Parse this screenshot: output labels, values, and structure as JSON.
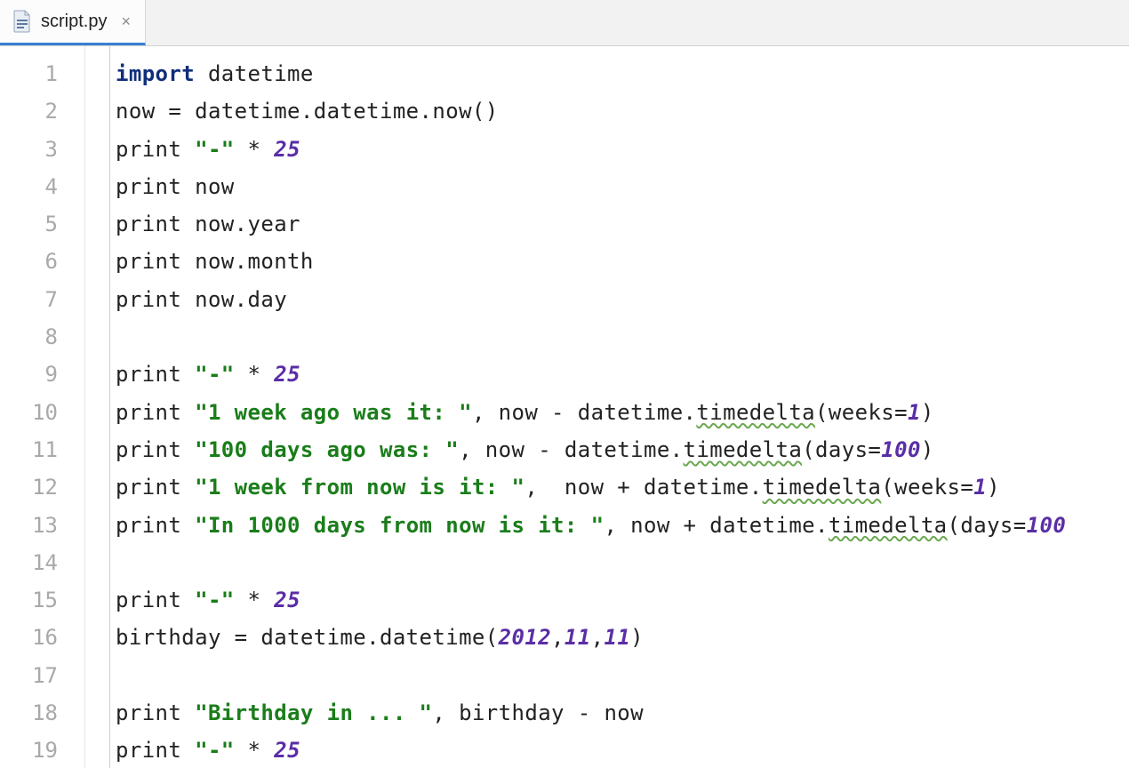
{
  "tab": {
    "filename": "script.py",
    "close_glyph": "×"
  },
  "gutter": {
    "start": 1,
    "end": 19
  },
  "code": {
    "lines": [
      [
        {
          "t": "import",
          "c": "kw"
        },
        {
          "t": " datetime",
          "c": ""
        }
      ],
      [
        {
          "t": "now = datetime.datetime.now()",
          "c": ""
        }
      ],
      [
        {
          "t": "print ",
          "c": ""
        },
        {
          "t": "\"-\"",
          "c": "str"
        },
        {
          "t": " * ",
          "c": ""
        },
        {
          "t": "25",
          "c": "num"
        }
      ],
      [
        {
          "t": "print now",
          "c": ""
        }
      ],
      [
        {
          "t": "print now.year",
          "c": ""
        }
      ],
      [
        {
          "t": "print now.month",
          "c": ""
        }
      ],
      [
        {
          "t": "print now.day",
          "c": ""
        }
      ],
      [],
      [
        {
          "t": "print ",
          "c": ""
        },
        {
          "t": "\"-\"",
          "c": "str"
        },
        {
          "t": " * ",
          "c": ""
        },
        {
          "t": "25",
          "c": "num"
        }
      ],
      [
        {
          "t": "print ",
          "c": ""
        },
        {
          "t": "\"1 week ago was it: \"",
          "c": "str"
        },
        {
          "t": ", now - datetime.",
          "c": ""
        },
        {
          "t": "timedelta",
          "c": "wavy"
        },
        {
          "t": "(weeks=",
          "c": ""
        },
        {
          "t": "1",
          "c": "num"
        },
        {
          "t": ")",
          "c": ""
        }
      ],
      [
        {
          "t": "print ",
          "c": ""
        },
        {
          "t": "\"100 days ago was: \"",
          "c": "str"
        },
        {
          "t": ", now - datetime.",
          "c": ""
        },
        {
          "t": "timedelta",
          "c": "wavy"
        },
        {
          "t": "(days=",
          "c": ""
        },
        {
          "t": "100",
          "c": "num"
        },
        {
          "t": ")",
          "c": ""
        }
      ],
      [
        {
          "t": "print ",
          "c": ""
        },
        {
          "t": "\"1 week from now is it: \"",
          "c": "str"
        },
        {
          "t": ",  now + datetime.",
          "c": ""
        },
        {
          "t": "timedelta",
          "c": "wavy"
        },
        {
          "t": "(weeks=",
          "c": ""
        },
        {
          "t": "1",
          "c": "num"
        },
        {
          "t": ")",
          "c": ""
        }
      ],
      [
        {
          "t": "print ",
          "c": ""
        },
        {
          "t": "\"In 1000 days from now is it: \"",
          "c": "str"
        },
        {
          "t": ", now + datetime.",
          "c": ""
        },
        {
          "t": "timedelta",
          "c": "wavy"
        },
        {
          "t": "(days=",
          "c": ""
        },
        {
          "t": "100",
          "c": "num"
        }
      ],
      [],
      [
        {
          "t": "print ",
          "c": ""
        },
        {
          "t": "\"-\"",
          "c": "str"
        },
        {
          "t": " * ",
          "c": ""
        },
        {
          "t": "25",
          "c": "num"
        }
      ],
      [
        {
          "t": "birthday = datetime.datetime(",
          "c": ""
        },
        {
          "t": "2012",
          "c": "num"
        },
        {
          "t": ",",
          "c": ""
        },
        {
          "t": "11",
          "c": "num"
        },
        {
          "t": ",",
          "c": ""
        },
        {
          "t": "11",
          "c": "num"
        },
        {
          "t": ")",
          "c": ""
        }
      ],
      [],
      [
        {
          "t": "print ",
          "c": ""
        },
        {
          "t": "\"Birthday in ... \"",
          "c": "str"
        },
        {
          "t": ", birthday - now",
          "c": ""
        }
      ],
      [
        {
          "t": "print ",
          "c": ""
        },
        {
          "t": "\"-\"",
          "c": "str"
        },
        {
          "t": " * ",
          "c": ""
        },
        {
          "t": "25",
          "c": "num"
        }
      ]
    ]
  }
}
